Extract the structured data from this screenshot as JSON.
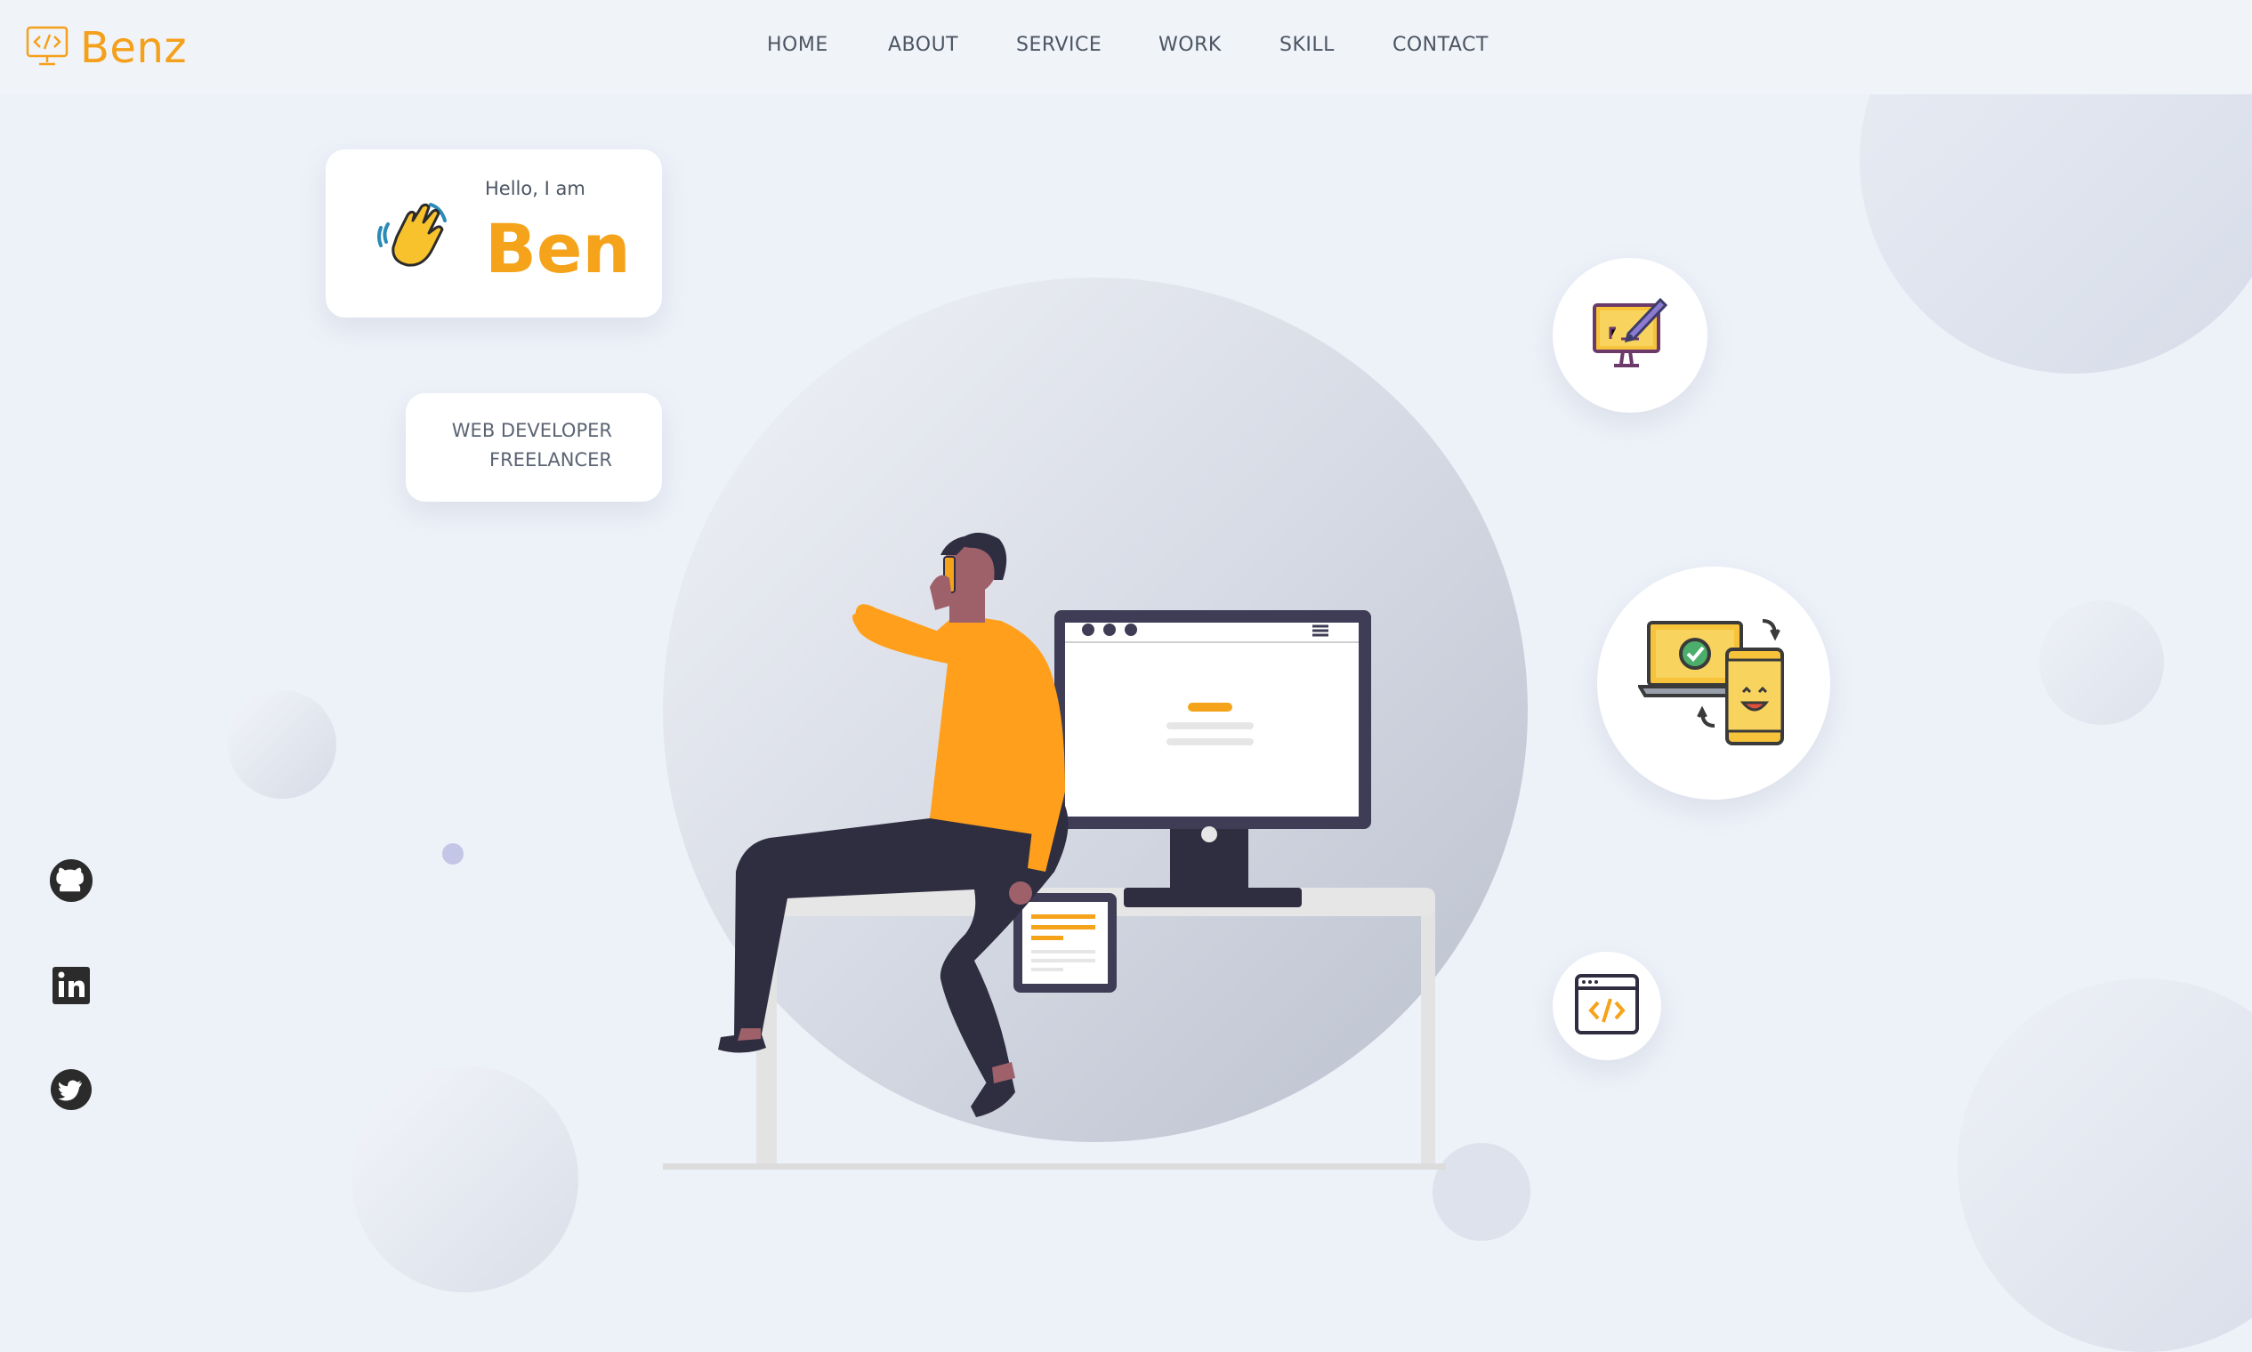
{
  "logo": {
    "text": "Benz",
    "icon": "code-monitor-icon",
    "color": "#f5a01a"
  },
  "nav": {
    "items": [
      {
        "label": "HOME"
      },
      {
        "label": "ABOUT"
      },
      {
        "label": "SERVICE"
      },
      {
        "label": "WORK"
      },
      {
        "label": "SKILL"
      },
      {
        "label": "CONTACT"
      }
    ]
  },
  "hero": {
    "greeting": "Hello, I am",
    "name": "Ben",
    "wave_icon": "waving-hand-icon",
    "roles": [
      "WEB DEVELOPER",
      "FREELANCER"
    ]
  },
  "services": [
    {
      "icon": "design-monitor-icon"
    },
    {
      "icon": "responsive-devices-icon"
    },
    {
      "icon": "code-window-icon"
    }
  ],
  "social": [
    {
      "icon": "github-icon"
    },
    {
      "icon": "linkedin-icon"
    },
    {
      "icon": "twitter-icon"
    }
  ],
  "colors": {
    "accent": "#f5a31a",
    "background": "#edf1f8",
    "text": "#4b5563",
    "dark": "#2f2e41"
  }
}
